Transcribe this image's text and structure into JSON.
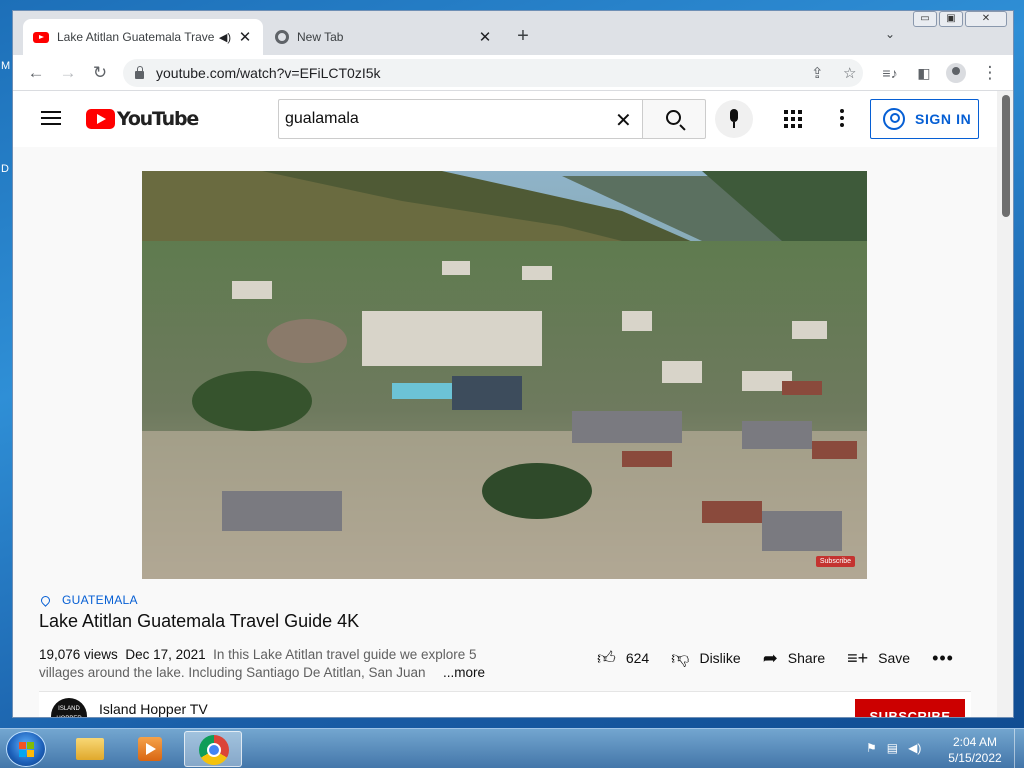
{
  "desktop": {
    "edge_glyph_1": "M",
    "edge_glyph_2": "D"
  },
  "browser": {
    "tabs": [
      {
        "title": "Lake Atitlan Guatemala Trave",
        "active": true,
        "icon": "youtube-favicon",
        "audio_icon": "speaker-icon"
      },
      {
        "title": "New Tab",
        "active": false,
        "icon": "chrome-favicon"
      }
    ],
    "new_tab_label": "+",
    "tab_search_label": "⌄",
    "window_controls": {
      "minimize": "▭",
      "maximize": "▣",
      "close": "✕"
    },
    "url": "youtube.com/watch?v=EFiLCT0zI5k",
    "toolbar_icons": [
      "back-icon",
      "forward-icon",
      "reload-icon",
      "share-icon",
      "star-icon",
      "media-control-icon",
      "side-panel-icon",
      "profile-icon",
      "menu-icon"
    ]
  },
  "youtube": {
    "logo_text": "YouTube",
    "search_value": "gualamala",
    "sign_in": "SIGN IN",
    "video": {
      "watermark": "Subscribe",
      "location_tag": "GUATEMALA",
      "title": "Lake Atitlan Guatemala Travel Guide 4K",
      "views": "19,076 views",
      "date": "Dec 17, 2021",
      "desc_line1": "In this Lake Atitlan travel guide we explore 5",
      "desc_line2": "villages around the lake. Including Santiago De Atitlan, San Juan",
      "more": "...more"
    },
    "actions": {
      "likes": "624",
      "dislike": "Dislike",
      "share": "Share",
      "save": "Save",
      "more": "•••"
    },
    "channel": {
      "name": "Island Hopper TV",
      "avatar_text": "ISLAND HOPPER",
      "subscribe": "SUBSCRIBE"
    },
    "colors": {
      "brand_red": "#ff0000",
      "link_blue": "#065fd4",
      "subscribe_red": "#cc0000"
    }
  },
  "taskbar": {
    "pinned": [
      "windows-explorer",
      "windows-media-player",
      "google-chrome"
    ],
    "time": "2:04 AM",
    "date": "5/15/2022",
    "tray_icons": [
      "action-center-icon",
      "network-icon",
      "volume-icon"
    ]
  }
}
